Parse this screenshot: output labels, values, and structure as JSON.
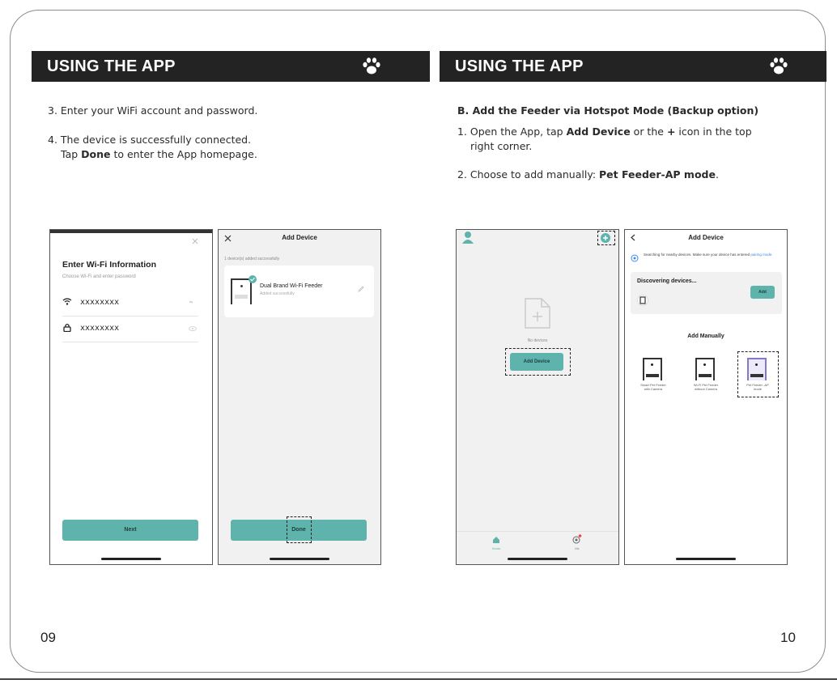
{
  "left_page": {
    "header": "USING THE APP",
    "step3": "3. Enter your WiFi account and password.",
    "step4_line1": "4. The device is successfully connected.",
    "step4_tap": "Tap ",
    "step4_done": "Done",
    "step4_rest": " to enter the App homepage.",
    "page_number": "09"
  },
  "right_page": {
    "header": "USING THE APP",
    "section_b": "B. Add the Feeder via Hotspot Mode (Backup option)",
    "step1_a": "1. Open the App, tap ",
    "step1_bold1": "Add Device",
    "step1_b": " or the ",
    "step1_bold2": "+",
    "step1_c": " icon in the top",
    "step1_line2": "right corner.",
    "step2_a": "2. Choose to add manually: ",
    "step2_bold": "Pet Feeder-AP mode",
    "step2_end": ".",
    "page_number": "10"
  },
  "screen_wifi": {
    "title": "Enter Wi-Fi Information",
    "subtitle": "Choose Wi-Fi and enter password",
    "ssid": "xxxxxxxx",
    "password": "xxxxxxxx",
    "next_button": "Next"
  },
  "screen_added": {
    "title": "Add Device",
    "added_note": "1 device(s) added successfully",
    "device_name": "Dual Brand Wi-Fi Feeder",
    "device_status": "Added successfully",
    "done_button": "Done"
  },
  "screen_home": {
    "empty_text": "No devices",
    "add_button": "Add Device",
    "tab_home": "Home",
    "tab_me": "Me"
  },
  "screen_add": {
    "title": "Add Device",
    "searching_text": "Searching for nearby devices. Make sure your device has entered",
    "pairing_link": "pairing mode.",
    "discovering": "Discovering devices...",
    "add_button": "Add",
    "manual_title": "Add Manually",
    "items": [
      {
        "label_line1": "Smart Pet Feeder",
        "label_line2": "with Camera"
      },
      {
        "label_line1": "Wi-Fi Pet Feeder",
        "label_line2": "without Camera"
      },
      {
        "label_line1": "Pet Feeder -AP",
        "label_line2": "mode"
      }
    ]
  },
  "colors": {
    "header_bg": "#232323",
    "teal": "#5fb3ad",
    "link_blue": "#3a8ee6"
  }
}
